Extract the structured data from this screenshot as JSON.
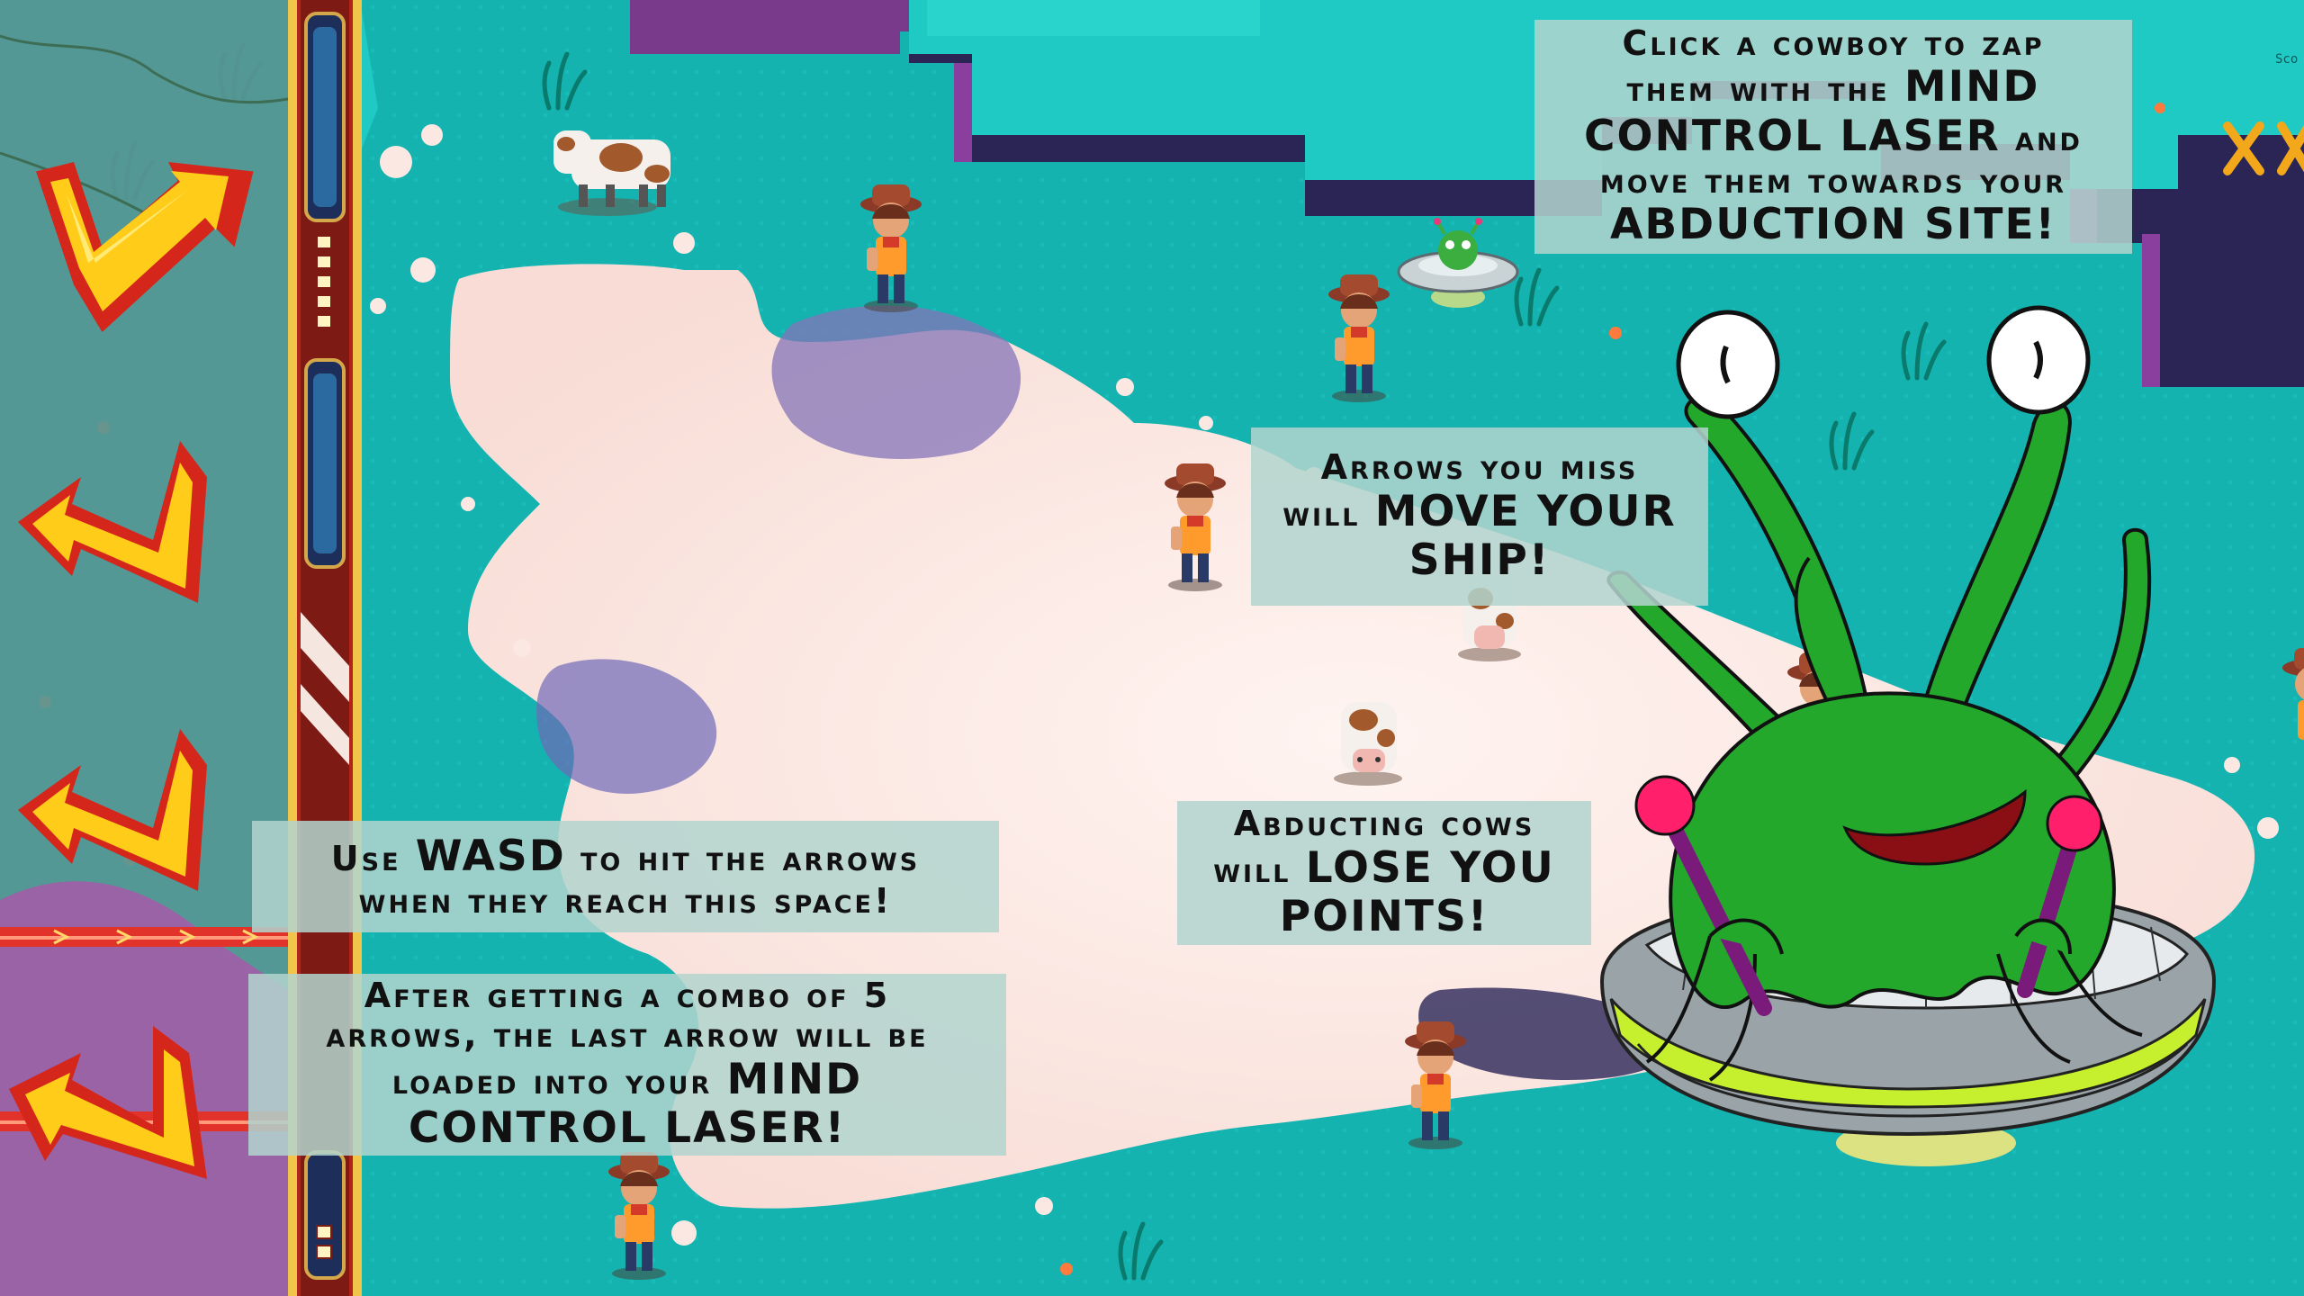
{
  "tutorial": {
    "cowboy_tip": {
      "line1": "Click a cowboy to zap",
      "line2a": "them with the",
      "line2b": "MIND",
      "line3a": "CONTROL LASER",
      "line3b": "and",
      "line4": "move them towards your",
      "line5": "ABDUCTION SITE!"
    },
    "miss_tip": {
      "line1": "Arrows you miss",
      "line2a": "will",
      "line2b": "MOVE YOUR",
      "line3": "SHIP!"
    },
    "cow_tip": {
      "line1": "Abducting cows",
      "line2a": "will",
      "line2b": "LOSE YOU",
      "line3": "POINTS!"
    },
    "wasd_tip": {
      "line1a": "Use",
      "line1b": "WASD",
      "line1c": "to hit the arrows",
      "line2": "when they reach this space!"
    },
    "combo_tip": {
      "line1": "After getting a combo of 5",
      "line2": "arrows, the last arrow will be",
      "line3a": "loaded into your",
      "line3b": "MIND",
      "line4": "CONTROL LASER!"
    }
  },
  "hud": {
    "score_hint": "Sco"
  },
  "arrow_lane": {
    "arrows": [
      {
        "direction": "up-right",
        "icon": "lightning-arrow-up-right-icon"
      },
      {
        "direction": "up-left",
        "icon": "lightning-arrow-up-left-icon"
      },
      {
        "direction": "up-left",
        "icon": "lightning-arrow-up-left-icon"
      },
      {
        "direction": "left",
        "icon": "lightning-arrow-left-icon"
      }
    ]
  },
  "colors": {
    "water": "#14b3b0",
    "cloud": "#fbe8e3",
    "cliff": "#2b2556",
    "lane_panel": "#5a9694",
    "arrow_fill": "#ffcc1a",
    "arrow_outline": "#d4261a",
    "alien_green": "#23a82c",
    "tip_background": "#b2d4ce"
  }
}
